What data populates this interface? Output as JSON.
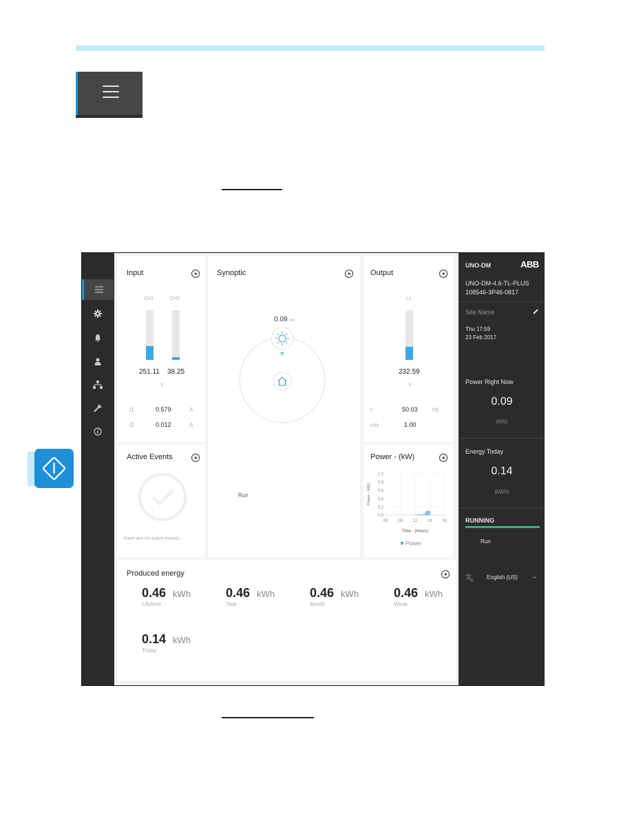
{
  "menu_callout": {
    "icon": "hamburger-menu-icon"
  },
  "power_callout": {
    "icon": "power-diamond-icon"
  },
  "nav": {
    "items": [
      {
        "name": "dashboard",
        "icon": "hamburger-menu-icon",
        "active": true
      },
      {
        "name": "settings",
        "icon": "gear-icon"
      },
      {
        "name": "alarms",
        "icon": "bell-icon"
      },
      {
        "name": "user",
        "icon": "user-icon"
      },
      {
        "name": "network",
        "icon": "network-icon"
      },
      {
        "name": "tools",
        "icon": "wrench-icon"
      },
      {
        "name": "info",
        "icon": "info-icon"
      }
    ]
  },
  "input": {
    "title": "Input",
    "channels": [
      {
        "label": "CH1",
        "value": "251.11",
        "fill": 0.28
      },
      {
        "label": "CH2",
        "value": "38.25",
        "fill": 0.05
      }
    ],
    "voltage_unit": "V",
    "currents": [
      {
        "label": "I1",
        "value": "0.579",
        "unit": "A"
      },
      {
        "label": "I2",
        "value": "0.012",
        "unit": "A"
      }
    ]
  },
  "synoptic": {
    "title": "Synoptic",
    "power_value": "0.09",
    "power_unit": "kW",
    "status": "Run"
  },
  "output": {
    "title": "Output",
    "phase_label": "L1",
    "value": "232.59",
    "fill": 0.27,
    "unit": "V",
    "rows": [
      {
        "label": "f",
        "value": "50.03",
        "unit": "Hz"
      },
      {
        "label": "cos",
        "value": "1.00",
        "unit": ""
      }
    ]
  },
  "active_events": {
    "title": "Active Events",
    "empty_text": "there are no active events"
  },
  "power_chart": {
    "title": "Power - (kW)"
  },
  "chart_data": {
    "type": "area",
    "title": "Power - (kW)",
    "xlabel": "Time - (Hours)",
    "ylabel": "Power - (kW)",
    "x_ticks": [
      "00",
      "06",
      "12",
      "18",
      "00"
    ],
    "y_ticks": [
      "0.0",
      "0.2",
      "0.4",
      "0.6",
      "0.8",
      "1.0"
    ],
    "ylim": [
      0,
      1.0
    ],
    "xlim": [
      0,
      24
    ],
    "grid": true,
    "legend": "bottom",
    "series": [
      {
        "name": "Power",
        "color": "#5aaee8",
        "x": [
          12,
          14,
          16,
          16.5,
          17.5,
          18,
          18
        ],
        "y": [
          0.0,
          0.005,
          0.01,
          0.09,
          0.09,
          0.09,
          0.0
        ]
      }
    ]
  },
  "produced_energy": {
    "title": "Produced energy",
    "items": [
      {
        "value": "0.46",
        "unit": "kWh",
        "label": "Lifetime"
      },
      {
        "value": "0.46",
        "unit": "kWh",
        "label": "Year"
      },
      {
        "value": "0.46",
        "unit": "kWh",
        "label": "Month"
      },
      {
        "value": "0.46",
        "unit": "kWh",
        "label": "Week"
      },
      {
        "value": "0.14",
        "unit": "kWh",
        "label": "Today"
      }
    ]
  },
  "side": {
    "device": "UNO-DM",
    "brand": "ABB",
    "model": "UNO-DM-4.6-TL-PLUS",
    "serial": "108546-3P46-0817",
    "site_name": "Site Name",
    "day_time": "Thu 17:59",
    "date": "23 Feb 2017",
    "power_now_label": "Power Right Now",
    "power_now_value": "0.09",
    "power_now_unit": "(kW)",
    "energy_today_label": "Energy Today",
    "energy_today_value": "0.14",
    "energy_today_unit": "(kWh)",
    "status_label": "RUNNING",
    "status_color": "#27b67c",
    "status_detail": "Run",
    "language": "English (US)"
  }
}
